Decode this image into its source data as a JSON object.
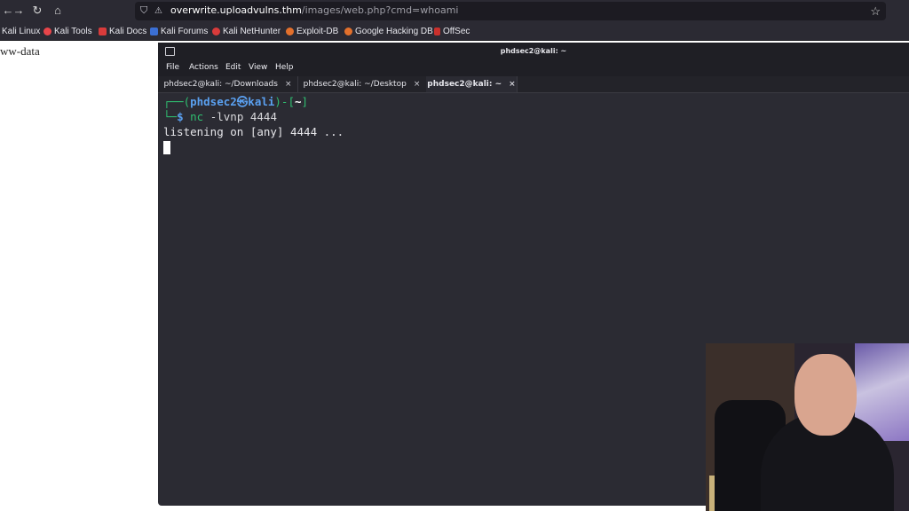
{
  "browser": {
    "url_host": "overwrite.uploadvulns.thm",
    "url_path": "/images/web.php?cmd=whoami",
    "url_prefix": "",
    "bookmarks": [
      {
        "label": "Kali Linux",
        "color": "#3b6fd4"
      },
      {
        "label": "Kali Tools",
        "color": "#e8454a"
      },
      {
        "label": "Kali Docs",
        "color": "#d93b3b"
      },
      {
        "label": "Kali Forums",
        "color": "#3b6fd4"
      },
      {
        "label": "Kali NetHunter",
        "color": "#d93b3b"
      },
      {
        "label": "Exploit-DB",
        "color": "#e3702c"
      },
      {
        "label": "Google Hacking DB",
        "color": "#e3702c"
      },
      {
        "label": "OffSec",
        "color": "#c9302c"
      }
    ]
  },
  "page": {
    "text": "ww-data"
  },
  "terminal": {
    "title": "phdsec2@kali: ~",
    "menu": [
      "File",
      "Actions",
      "Edit",
      "View",
      "Help"
    ],
    "tabs": [
      {
        "label": "phdsec2@kali: ~/Downloads",
        "close": "×"
      },
      {
        "label": "phdsec2@kali: ~/Desktop",
        "close": "×"
      },
      {
        "label": "phdsec2@kali: ~",
        "close": "×"
      }
    ],
    "prompt": {
      "top_prefix": "┌──(",
      "user_host": "phdsec2㉿kali",
      "top_mid": ")-[",
      "dir": "~",
      "top_suffix": "]",
      "bottom_prefix": "└─",
      "dollar": "$",
      "command": "nc",
      "args": "-lvnp 4444"
    },
    "output": "listening on [any] 4444 ..."
  },
  "colors": {
    "terminal_bg": "#2b2b33",
    "prompt_blue": "#3b8eea",
    "command_green": "#2fbf71"
  }
}
